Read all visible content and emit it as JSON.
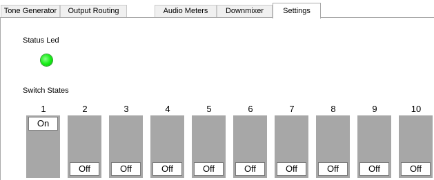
{
  "tabs": [
    {
      "label": "Tone Generator",
      "active": false
    },
    {
      "label": "Output Routing",
      "active": false
    },
    {
      "label": "Audio Meters",
      "active": false
    },
    {
      "label": "Downmixer",
      "active": false
    },
    {
      "label": "Settings",
      "active": true
    }
  ],
  "status_led": {
    "label": "Status Led",
    "color": "#1aef1a",
    "state": "on"
  },
  "switches": {
    "label": "Switch States",
    "items": [
      {
        "number": "1",
        "state": "On"
      },
      {
        "number": "2",
        "state": "Off"
      },
      {
        "number": "3",
        "state": "Off"
      },
      {
        "number": "4",
        "state": "Off"
      },
      {
        "number": "5",
        "state": "Off"
      },
      {
        "number": "6",
        "state": "Off"
      },
      {
        "number": "7",
        "state": "Off"
      },
      {
        "number": "8",
        "state": "Off"
      },
      {
        "number": "9",
        "state": "Off"
      },
      {
        "number": "10",
        "state": "Off"
      }
    ]
  }
}
